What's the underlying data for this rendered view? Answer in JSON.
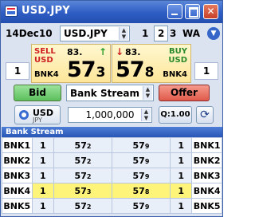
{
  "window": {
    "title": "USD.JPY"
  },
  "toolbar": {
    "date": "14Dec10",
    "pair": "USD.JPY",
    "views": [
      "1",
      "2",
      "3"
    ],
    "wa_label": "WA"
  },
  "quote": {
    "sell": {
      "side_line1": "SELL",
      "side_line2": "USD",
      "bank": "BNK4",
      "big_figure": "83.",
      "pips": "57",
      "fraction": "3",
      "amount": "1"
    },
    "buy": {
      "side_line1": "BUY",
      "side_line2": "USD",
      "bank": "BNK4",
      "big_figure": "83.",
      "pips": "57",
      "fraction": "8",
      "amount": "1"
    }
  },
  "actions": {
    "bid_label": "Bid",
    "offer_label": "Offer",
    "stream_selected": "Bank Stream"
  },
  "amount": {
    "ccy_main": "USD",
    "ccy_sub": "JPY",
    "value": "1,000,000",
    "q_label": "Q:1.00"
  },
  "stream": {
    "header": "Bank Stream",
    "rows": [
      {
        "bank_l": "BNK1",
        "bid_amt": "1",
        "bid": "57",
        "bid_frac": "2",
        "offer": "57",
        "offer_frac": "9",
        "offer_amt": "1",
        "bank_r": "BNK1"
      },
      {
        "bank_l": "BNK2",
        "bid_amt": "1",
        "bid": "57",
        "bid_frac": "2",
        "offer": "57",
        "offer_frac": "9",
        "offer_amt": "1",
        "bank_r": "BNK2"
      },
      {
        "bank_l": "BNK3",
        "bid_amt": "1",
        "bid": "57",
        "bid_frac": "2",
        "offer": "57",
        "offer_frac": "9",
        "offer_amt": "1",
        "bank_r": "BNK3"
      },
      {
        "bank_l": "BNK4",
        "bid_amt": "1",
        "bid": "57",
        "bid_frac": "3",
        "offer": "57",
        "offer_frac": "8",
        "offer_amt": "1",
        "bank_r": "BNK4"
      },
      {
        "bank_l": "BNK5",
        "bid_amt": "1",
        "bid": "57",
        "bid_frac": "2",
        "offer": "57",
        "offer_frac": "9",
        "offer_amt": "1",
        "bank_r": "BNK5"
      }
    ]
  },
  "icons": {
    "up_arrow": "↑",
    "down_arrow": "↓",
    "refresh": "⟳",
    "dropdown": "▾"
  },
  "colors": {
    "title_bar": "#2d5cc4",
    "sell": "#d02020",
    "buy": "#2a8a2a",
    "quote_panel": "#fde69a",
    "best_row": "#fff47a",
    "bid_button": "#5cbf5c",
    "offer_button": "#e05a4a"
  }
}
